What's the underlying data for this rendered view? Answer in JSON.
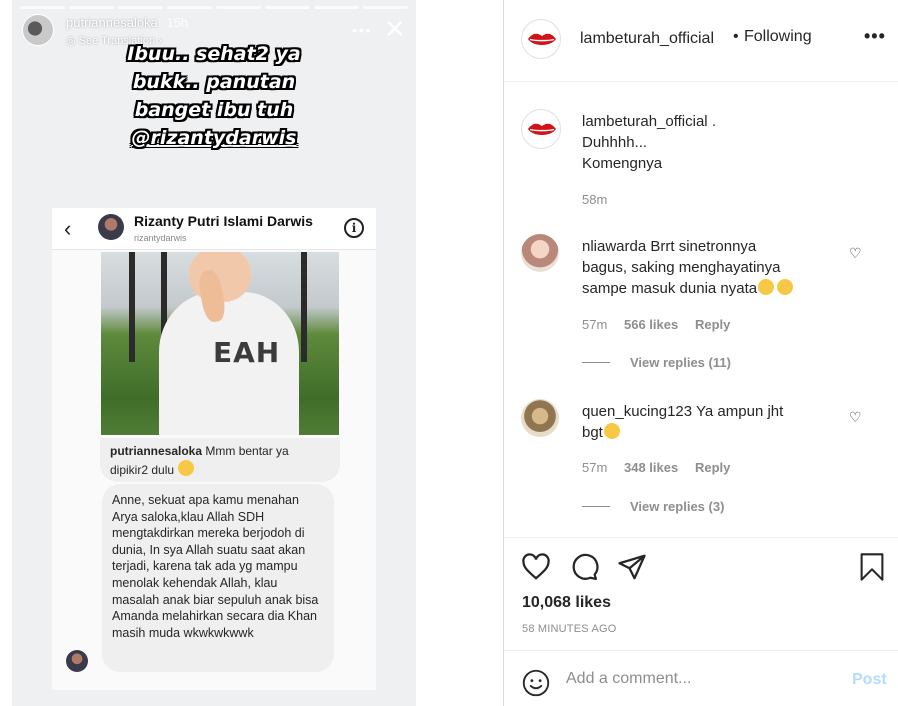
{
  "story": {
    "username": "putriannesaloka",
    "time": "15h",
    "see_translation": "See Translation",
    "caption_lines": [
      "Ibuu.. sehat2 ya",
      "bukk.. panutan",
      "banget ibu tuh"
    ],
    "caption_mention": "@rizantydarwis",
    "dm": {
      "contact_name": "Rizanty Putri Islami Darwis",
      "contact_handle": "rizantydarwis",
      "photo_shirt_text": "EAH",
      "reply_user": "putriannesaloka",
      "reply_text": "Mmm bentar ya dipikir2 dulu",
      "message": "Anne, sekuat apa kamu menahan Arya saloka,klau Allah SDH mengtakdirkan mereka berjodoh di dunia, In sya Allah suatu saat akan terjadi, karena tak ada yg mampu menolak kehendak Allah, klau masalah anak biar sepuluh anak bisa Amanda melahirkan secara dia Khan masih muda wkwkwkwwk"
    }
  },
  "post": {
    "header": {
      "username": "lambeturah_official",
      "dot": "•",
      "follow_status": "Following"
    },
    "caption": {
      "username": "lambeturah_official",
      "line1_suffix": ".",
      "line2": "Duhhhh...",
      "line3": "Komengnya",
      "time": "58m"
    },
    "comments": [
      {
        "username": "nliawarda",
        "line1": "Brrt sinetronnya",
        "line2": "bagus, saking menghayatinya",
        "line3": "sampe masuk dunia nyata",
        "time": "57m",
        "likes": "566 likes",
        "reply": "Reply",
        "view_replies": "View replies (11)"
      },
      {
        "username": "quen_kucing123",
        "line1": "Ya ampun jht",
        "line2": "bgt",
        "time": "57m",
        "likes": "348 likes",
        "reply": "Reply",
        "view_replies": "View replies (3)"
      }
    ],
    "likes_count": "10,068 likes",
    "posted_ago": "58 MINUTES AGO",
    "add_comment_placeholder": "Add a comment...",
    "post_button": "Post"
  },
  "colors": {
    "link_disabled": "#b3dbff",
    "secondary_text": "#8e8e8e",
    "lips_red": "#d0141a"
  },
  "icons": [
    "lips-logo-icon",
    "more-icon",
    "heart-icon",
    "comment-icon",
    "share-icon",
    "bookmark-icon",
    "smile-icon",
    "close-icon",
    "back-arrow-icon",
    "info-icon"
  ]
}
